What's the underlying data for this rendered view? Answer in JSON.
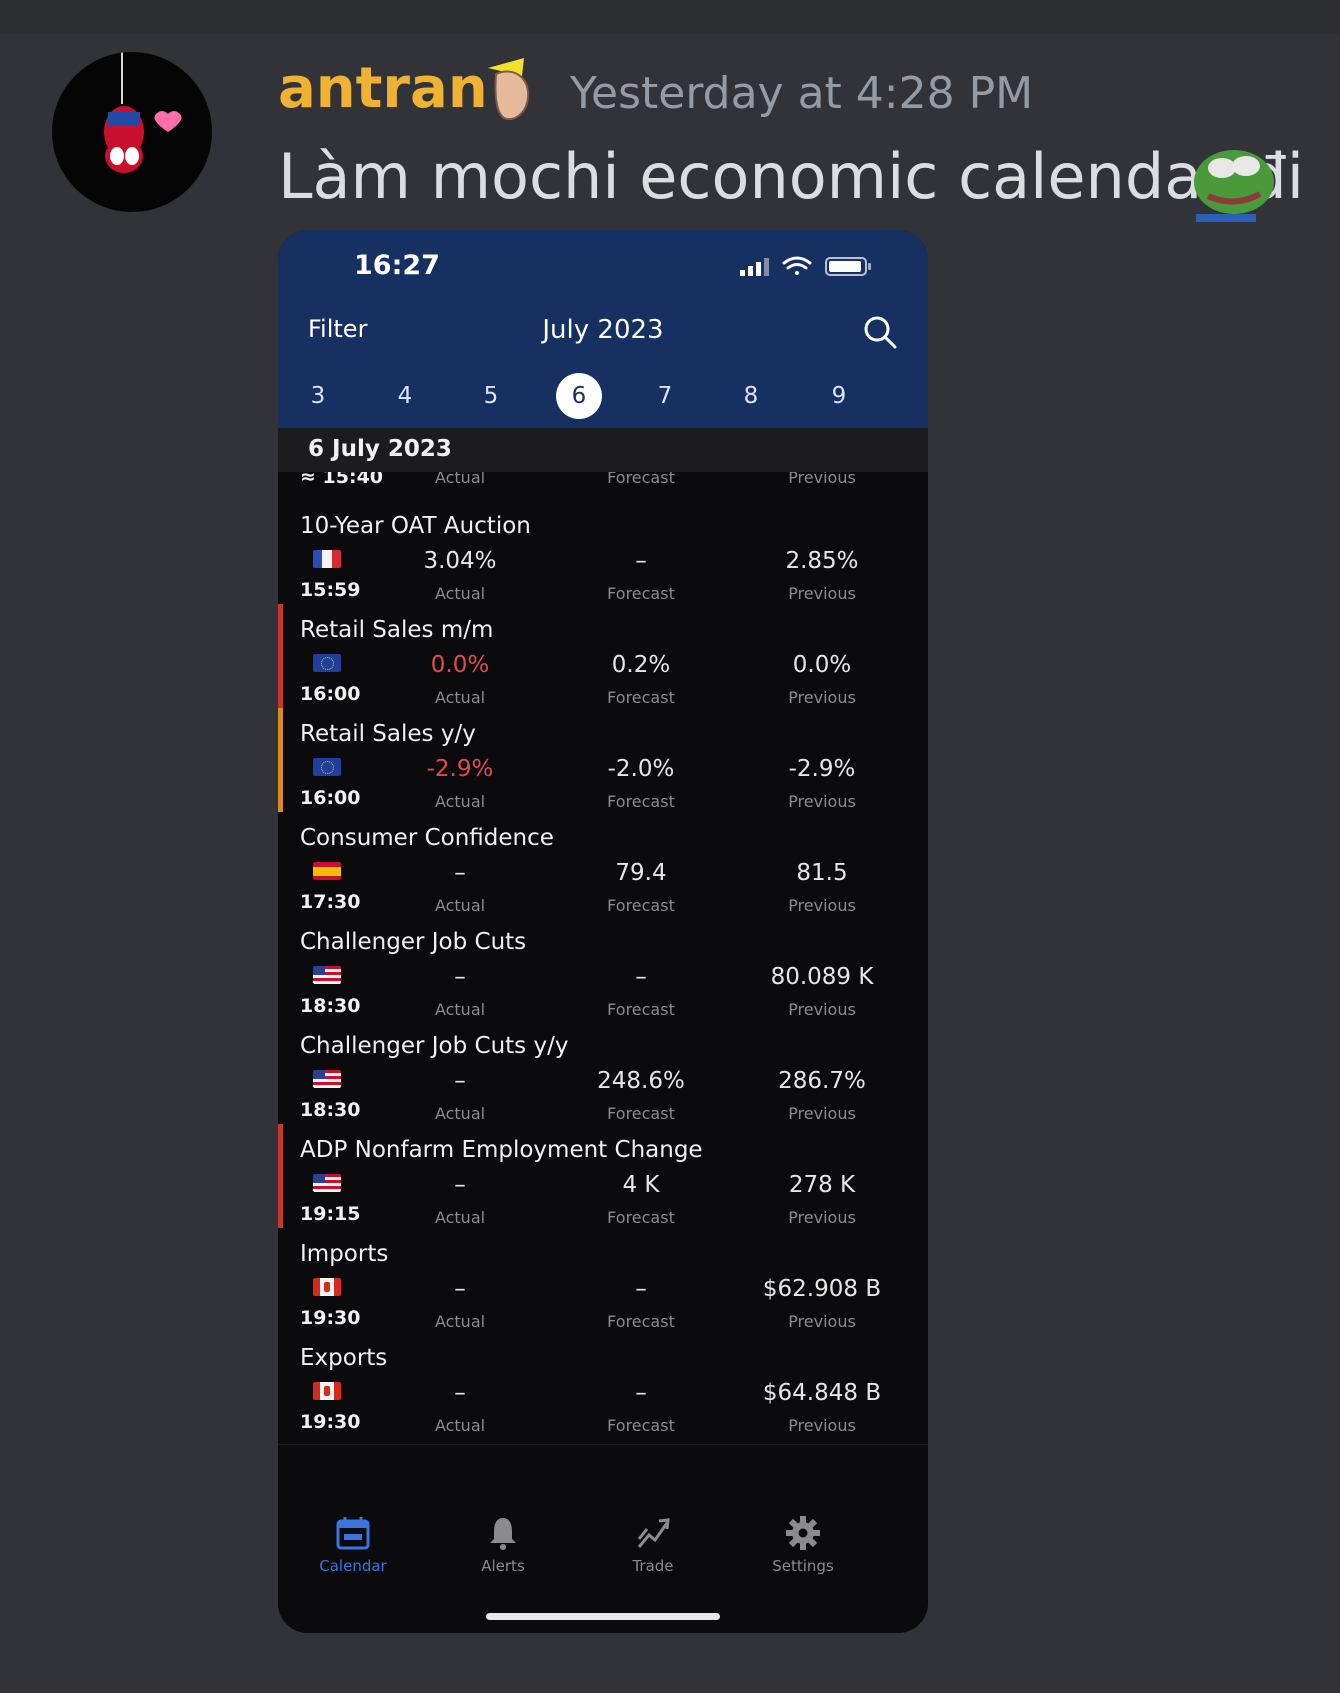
{
  "discord": {
    "username": "antran",
    "timestamp": "Yesterday at 4:28 PM",
    "message": "Làm mochi economic calendar đi",
    "avatar_icon": "spiderman-hanging-icon",
    "username_color": "#f0b232"
  },
  "phone": {
    "status_time": "16:27",
    "filter_label": "Filter",
    "month_title": "July 2023",
    "days": [
      "3",
      "4",
      "5",
      "6",
      "7",
      "8",
      "9"
    ],
    "selected_day": "6",
    "date_header": "6 July 2023",
    "partial_row": {
      "time": "≈ 15:40",
      "actual_label": "Actual",
      "forecast_label": "Forecast",
      "previous_label": "Previous"
    },
    "events": [
      {
        "name": "10-Year OAT Auction",
        "time": "15:59",
        "flag": "france",
        "impact_color": "",
        "actual": "3.04%",
        "actual_red": false,
        "forecast": "–",
        "previous": "2.85%"
      },
      {
        "name": "Retail Sales m/m",
        "time": "16:00",
        "flag": "eu",
        "impact_color": "#c0392b",
        "actual": "0.0%",
        "actual_red": true,
        "forecast": "0.2%",
        "previous": "0.0%"
      },
      {
        "name": "Retail Sales y/y",
        "time": "16:00",
        "flag": "eu",
        "impact_color": "#d98c24",
        "actual": "-2.9%",
        "actual_red": true,
        "forecast": "-2.0%",
        "previous": "-2.9%"
      },
      {
        "name": "Consumer Confidence",
        "time": "17:30",
        "flag": "spain",
        "impact_color": "",
        "actual": "–",
        "actual_red": false,
        "forecast": "79.4",
        "previous": "81.5"
      },
      {
        "name": "Challenger Job Cuts",
        "time": "18:30",
        "flag": "usa",
        "impact_color": "",
        "actual": "–",
        "actual_red": false,
        "forecast": "–",
        "previous": "80.089 K"
      },
      {
        "name": "Challenger Job Cuts y/y",
        "time": "18:30",
        "flag": "usa",
        "impact_color": "",
        "actual": "–",
        "actual_red": false,
        "forecast": "248.6%",
        "previous": "286.7%"
      },
      {
        "name": "ADP Nonfarm Employment Change",
        "time": "19:15",
        "flag": "usa",
        "impact_color": "#c0392b",
        "actual": "–",
        "actual_red": false,
        "forecast": "4 K",
        "previous": "278 K"
      },
      {
        "name": "Imports",
        "time": "19:30",
        "flag": "canada",
        "impact_color": "",
        "actual": "–",
        "actual_red": false,
        "forecast": "–",
        "previous": "$62.908 B"
      },
      {
        "name": "Exports",
        "time": "19:30",
        "flag": "canada",
        "impact_color": "",
        "actual": "–",
        "actual_red": false,
        "forecast": "–",
        "previous": "$64.848 B"
      }
    ],
    "column_labels": {
      "actual": "Actual",
      "forecast": "Forecast",
      "previous": "Previous"
    },
    "tabs": [
      {
        "label": "Calendar",
        "icon": "calendar-icon",
        "active": true
      },
      {
        "label": "Alerts",
        "icon": "bell-icon",
        "active": false
      },
      {
        "label": "Trade",
        "icon": "trend-up-icon",
        "active": false
      },
      {
        "label": "Settings",
        "icon": "gear-icon",
        "active": false
      }
    ],
    "colors": {
      "header_bg": "#173062",
      "active_tab": "#3a74e0",
      "inactive_tab": "#8b8b8e",
      "negative": "#e34b4b"
    }
  }
}
